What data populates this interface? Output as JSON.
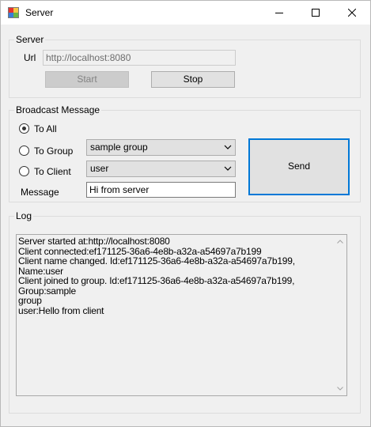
{
  "window": {
    "title": "Server"
  },
  "server": {
    "group_label": "Server",
    "url_label": "Url",
    "url_value": "http://localhost:8080",
    "start_label": "Start",
    "stop_label": "Stop"
  },
  "broadcast": {
    "group_label": "Broadcast Message",
    "to_all_label": "To All",
    "to_group_label": "To Group",
    "to_client_label": "To Client",
    "message_label": "Message",
    "group_selected": "sample group",
    "client_selected": "user",
    "message_value": "Hi from server",
    "send_label": "Send",
    "selected_option": "to_all"
  },
  "log": {
    "group_label": "Log",
    "lines": [
      "Server started at:http://localhost:8080",
      "Client connected:ef171125-36a6-4e8b-a32a-a54697a7b199",
      "Client name changed. Id:ef171125-36a6-4e8b-a32a-a54697a7b199, Name:user",
      "Client joined to group. Id:ef171125-36a6-4e8b-a32a-a54697a7b199, Group:sample",
      "group",
      "user:Hello from client"
    ]
  }
}
